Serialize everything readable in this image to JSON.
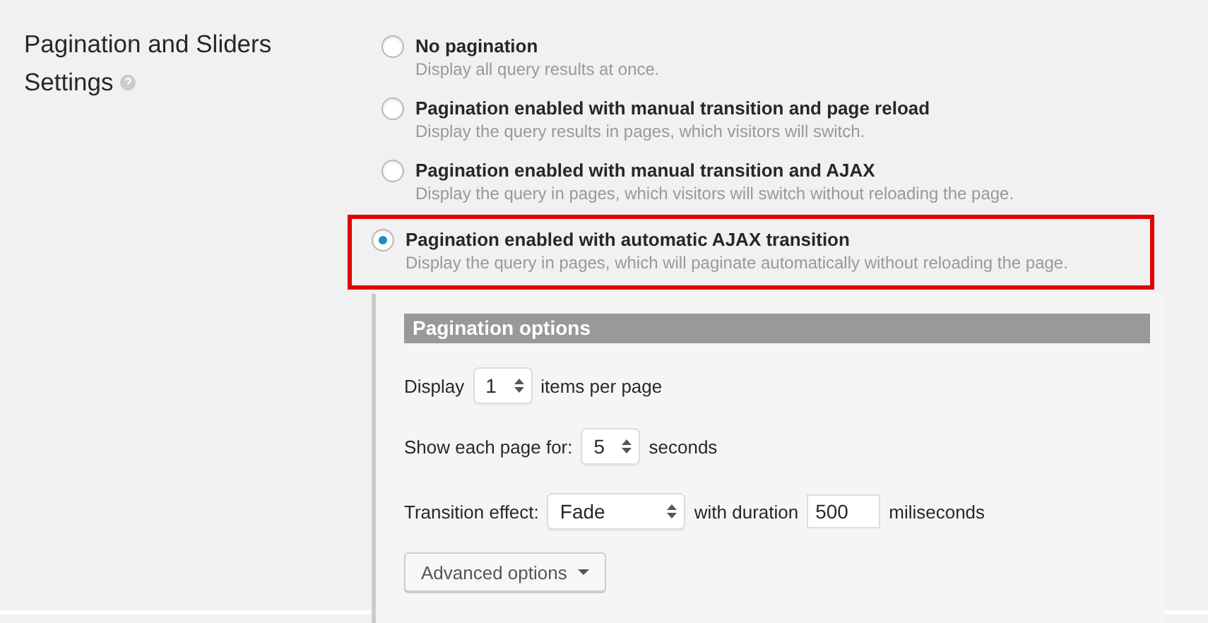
{
  "section_label_lines": [
    "Pagination and Sliders",
    "Settings"
  ],
  "options": [
    {
      "title": "No pagination",
      "description": "Display all query results at once.",
      "selected": false,
      "highlighted": false
    },
    {
      "title": "Pagination enabled with manual transition and page reload",
      "description": "Display the query results in pages, which visitors will switch.",
      "selected": false,
      "highlighted": false
    },
    {
      "title": "Pagination enabled with manual transition and AJAX",
      "description": "Display the query in pages, which visitors will switch without reloading the page.",
      "selected": false,
      "highlighted": false
    },
    {
      "title": "Pagination enabled with automatic AJAX transition",
      "description": "Display the query in pages, which will paginate automatically without reloading the page.",
      "selected": true,
      "highlighted": true
    }
  ],
  "pagination_options": {
    "header": "Pagination options",
    "items_row": {
      "label": "Display",
      "value": "1",
      "suffix": "items per page"
    },
    "duration_row": {
      "label": "Show each page for:",
      "value": "5",
      "suffix": "seconds"
    },
    "transition_row": {
      "label": "Transition effect:",
      "effect": "Fade",
      "middle": "with duration",
      "duration": "500",
      "suffix": "miliseconds"
    },
    "advanced_button": "Advanced options"
  }
}
